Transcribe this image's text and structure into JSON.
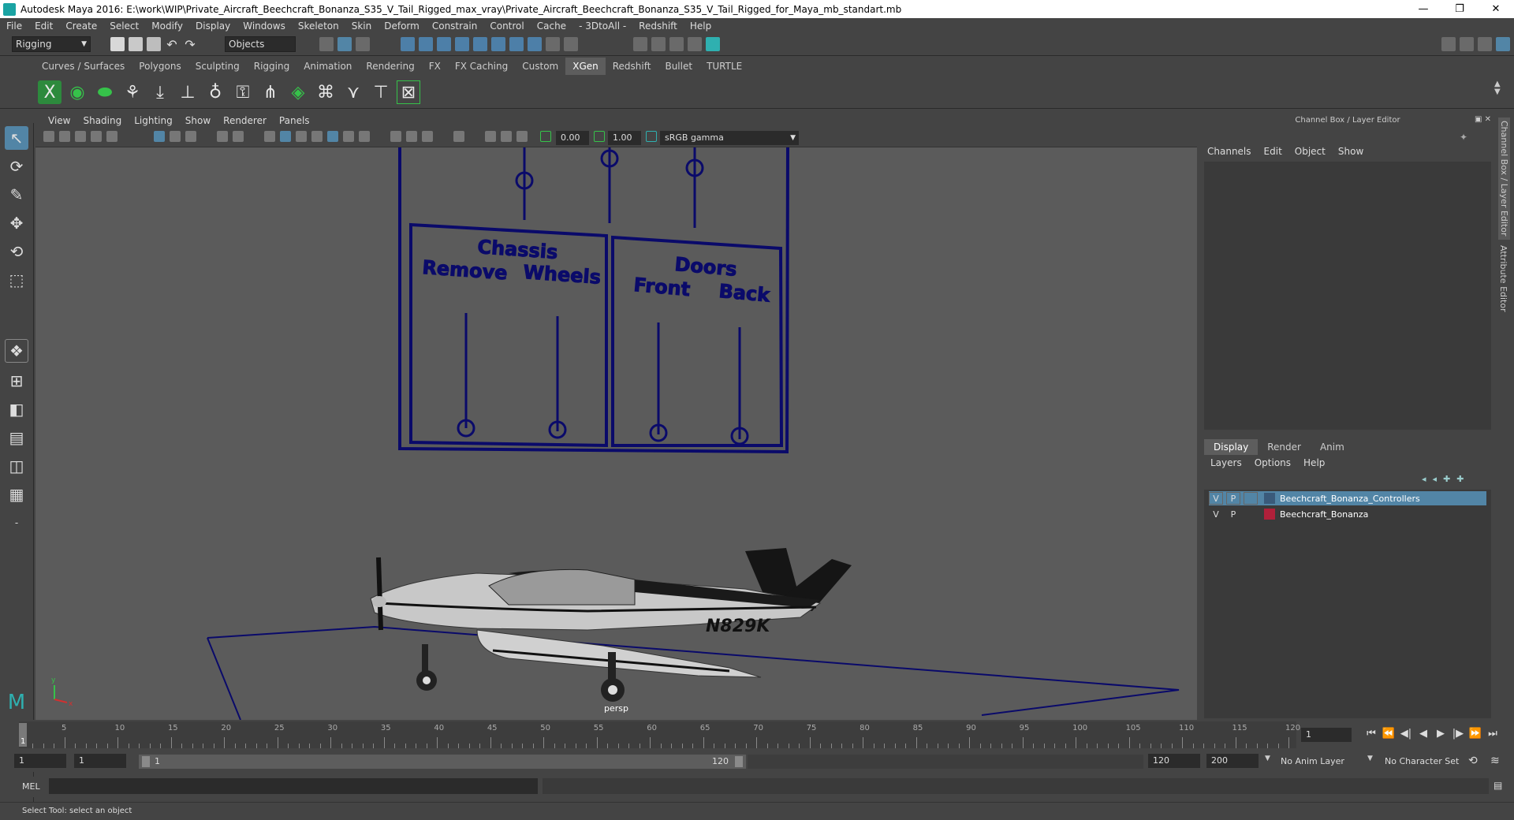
{
  "window": {
    "title": "Autodesk Maya 2016: E:\\work\\WIP\\Private_Aircraft_Beechcraft_Bonanza_S35_V_Tail_Rigged_max_vray\\Private_Aircraft_Beechcraft_Bonanza_S35_V_Tail_Rigged_for_Maya_mb_standart.mb",
    "minimize": "—",
    "restore": "❐",
    "close": "✕"
  },
  "menubar": [
    "File",
    "Edit",
    "Create",
    "Select",
    "Modify",
    "Display",
    "Windows",
    "Skeleton",
    "Skin",
    "Deform",
    "Constrain",
    "Control",
    "Cache",
    "- 3DtoAll -",
    "Redshift",
    "Help"
  ],
  "status": {
    "mode": "Rigging",
    "selection_mask": "Objects"
  },
  "shelf_tabs": [
    {
      "label": "Curves / Surfaces",
      "active": false
    },
    {
      "label": "Polygons",
      "active": false
    },
    {
      "label": "Sculpting",
      "active": false
    },
    {
      "label": "Rigging",
      "active": false
    },
    {
      "label": "Animation",
      "active": false
    },
    {
      "label": "Rendering",
      "active": false
    },
    {
      "label": "FX",
      "active": false
    },
    {
      "label": "FX Caching",
      "active": false
    },
    {
      "label": "Custom",
      "active": false
    },
    {
      "label": "XGen",
      "active": true
    },
    {
      "label": "Redshift",
      "active": false
    },
    {
      "label": "Bullet",
      "active": false
    },
    {
      "label": "TURTLE",
      "active": false
    }
  ],
  "viewport": {
    "menu": [
      "View",
      "Shading",
      "Lighting",
      "Show",
      "Renderer",
      "Panels"
    ],
    "exposure": "0.00",
    "gamma": "1.00",
    "color_space": "sRGB gamma",
    "camera": "persp",
    "panel_labels": {
      "chassis": "Chassis",
      "remove": "Remove",
      "wheels": "Wheels",
      "doors": "Doors",
      "front": "Front",
      "back": "Back"
    },
    "tail_number": "N829K"
  },
  "right_panel": {
    "header": "Channel Box / Layer Editor",
    "menu": [
      "Channels",
      "Edit",
      "Object",
      "Show"
    ],
    "layer_tabs": [
      {
        "label": "Display",
        "active": true
      },
      {
        "label": "Render",
        "active": false
      },
      {
        "label": "Anim",
        "active": false
      }
    ],
    "layer_menu": [
      "Layers",
      "Options",
      "Help"
    ],
    "layers": [
      {
        "v": "V",
        "p": "P",
        "name": "Beechcraft_Bonanza_Controllers",
        "color": "#3a5a7a",
        "selected": true
      },
      {
        "v": "V",
        "p": "P",
        "name": "Beechcraft_Bonanza",
        "color": "#b0203a",
        "selected": false
      }
    ],
    "side_tabs": [
      "Channel Box / Layer Editor",
      "Attribute Editor"
    ]
  },
  "timeline": {
    "ticks": [
      5,
      10,
      15,
      20,
      25,
      30,
      35,
      40,
      45,
      50,
      55,
      60,
      65,
      70,
      75,
      80,
      85,
      90,
      95,
      100,
      105,
      110,
      115,
      120
    ],
    "start_label": "1",
    "current_frame": "1"
  },
  "range": {
    "start": "1",
    "playback_start": "1",
    "slider_start": "1",
    "slider_end": "120",
    "end": "120",
    "max": "200",
    "anim_layer": "No Anim Layer",
    "char_set": "No Character Set"
  },
  "cmd": {
    "label": "MEL"
  },
  "help_line": "Select Tool: select an object"
}
